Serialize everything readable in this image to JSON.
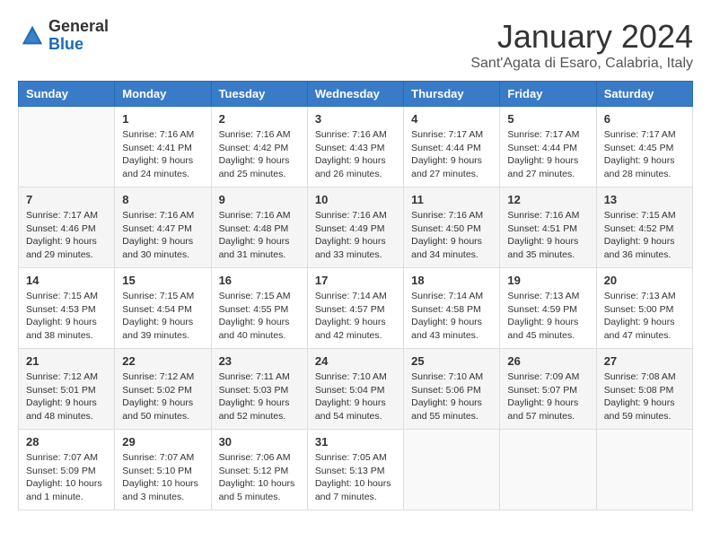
{
  "header": {
    "logo_line1": "General",
    "logo_line2": "Blue",
    "month": "January 2024",
    "location": "Sant'Agata di Esaro, Calabria, Italy"
  },
  "weekdays": [
    "Sunday",
    "Monday",
    "Tuesday",
    "Wednesday",
    "Thursday",
    "Friday",
    "Saturday"
  ],
  "weeks": [
    [
      {
        "day": "",
        "info": ""
      },
      {
        "day": "1",
        "info": "Sunrise: 7:16 AM\nSunset: 4:41 PM\nDaylight: 9 hours\nand 24 minutes."
      },
      {
        "day": "2",
        "info": "Sunrise: 7:16 AM\nSunset: 4:42 PM\nDaylight: 9 hours\nand 25 minutes."
      },
      {
        "day": "3",
        "info": "Sunrise: 7:16 AM\nSunset: 4:43 PM\nDaylight: 9 hours\nand 26 minutes."
      },
      {
        "day": "4",
        "info": "Sunrise: 7:17 AM\nSunset: 4:44 PM\nDaylight: 9 hours\nand 27 minutes."
      },
      {
        "day": "5",
        "info": "Sunrise: 7:17 AM\nSunset: 4:44 PM\nDaylight: 9 hours\nand 27 minutes."
      },
      {
        "day": "6",
        "info": "Sunrise: 7:17 AM\nSunset: 4:45 PM\nDaylight: 9 hours\nand 28 minutes."
      }
    ],
    [
      {
        "day": "7",
        "info": "Sunrise: 7:17 AM\nSunset: 4:46 PM\nDaylight: 9 hours\nand 29 minutes."
      },
      {
        "day": "8",
        "info": "Sunrise: 7:16 AM\nSunset: 4:47 PM\nDaylight: 9 hours\nand 30 minutes."
      },
      {
        "day": "9",
        "info": "Sunrise: 7:16 AM\nSunset: 4:48 PM\nDaylight: 9 hours\nand 31 minutes."
      },
      {
        "day": "10",
        "info": "Sunrise: 7:16 AM\nSunset: 4:49 PM\nDaylight: 9 hours\nand 33 minutes."
      },
      {
        "day": "11",
        "info": "Sunrise: 7:16 AM\nSunset: 4:50 PM\nDaylight: 9 hours\nand 34 minutes."
      },
      {
        "day": "12",
        "info": "Sunrise: 7:16 AM\nSunset: 4:51 PM\nDaylight: 9 hours\nand 35 minutes."
      },
      {
        "day": "13",
        "info": "Sunrise: 7:15 AM\nSunset: 4:52 PM\nDaylight: 9 hours\nand 36 minutes."
      }
    ],
    [
      {
        "day": "14",
        "info": "Sunrise: 7:15 AM\nSunset: 4:53 PM\nDaylight: 9 hours\nand 38 minutes."
      },
      {
        "day": "15",
        "info": "Sunrise: 7:15 AM\nSunset: 4:54 PM\nDaylight: 9 hours\nand 39 minutes."
      },
      {
        "day": "16",
        "info": "Sunrise: 7:15 AM\nSunset: 4:55 PM\nDaylight: 9 hours\nand 40 minutes."
      },
      {
        "day": "17",
        "info": "Sunrise: 7:14 AM\nSunset: 4:57 PM\nDaylight: 9 hours\nand 42 minutes."
      },
      {
        "day": "18",
        "info": "Sunrise: 7:14 AM\nSunset: 4:58 PM\nDaylight: 9 hours\nand 43 minutes."
      },
      {
        "day": "19",
        "info": "Sunrise: 7:13 AM\nSunset: 4:59 PM\nDaylight: 9 hours\nand 45 minutes."
      },
      {
        "day": "20",
        "info": "Sunrise: 7:13 AM\nSunset: 5:00 PM\nDaylight: 9 hours\nand 47 minutes."
      }
    ],
    [
      {
        "day": "21",
        "info": "Sunrise: 7:12 AM\nSunset: 5:01 PM\nDaylight: 9 hours\nand 48 minutes."
      },
      {
        "day": "22",
        "info": "Sunrise: 7:12 AM\nSunset: 5:02 PM\nDaylight: 9 hours\nand 50 minutes."
      },
      {
        "day": "23",
        "info": "Sunrise: 7:11 AM\nSunset: 5:03 PM\nDaylight: 9 hours\nand 52 minutes."
      },
      {
        "day": "24",
        "info": "Sunrise: 7:10 AM\nSunset: 5:04 PM\nDaylight: 9 hours\nand 54 minutes."
      },
      {
        "day": "25",
        "info": "Sunrise: 7:10 AM\nSunset: 5:06 PM\nDaylight: 9 hours\nand 55 minutes."
      },
      {
        "day": "26",
        "info": "Sunrise: 7:09 AM\nSunset: 5:07 PM\nDaylight: 9 hours\nand 57 minutes."
      },
      {
        "day": "27",
        "info": "Sunrise: 7:08 AM\nSunset: 5:08 PM\nDaylight: 9 hours\nand 59 minutes."
      }
    ],
    [
      {
        "day": "28",
        "info": "Sunrise: 7:07 AM\nSunset: 5:09 PM\nDaylight: 10 hours\nand 1 minute."
      },
      {
        "day": "29",
        "info": "Sunrise: 7:07 AM\nSunset: 5:10 PM\nDaylight: 10 hours\nand 3 minutes."
      },
      {
        "day": "30",
        "info": "Sunrise: 7:06 AM\nSunset: 5:12 PM\nDaylight: 10 hours\nand 5 minutes."
      },
      {
        "day": "31",
        "info": "Sunrise: 7:05 AM\nSunset: 5:13 PM\nDaylight: 10 hours\nand 7 minutes."
      },
      {
        "day": "",
        "info": ""
      },
      {
        "day": "",
        "info": ""
      },
      {
        "day": "",
        "info": ""
      }
    ]
  ]
}
